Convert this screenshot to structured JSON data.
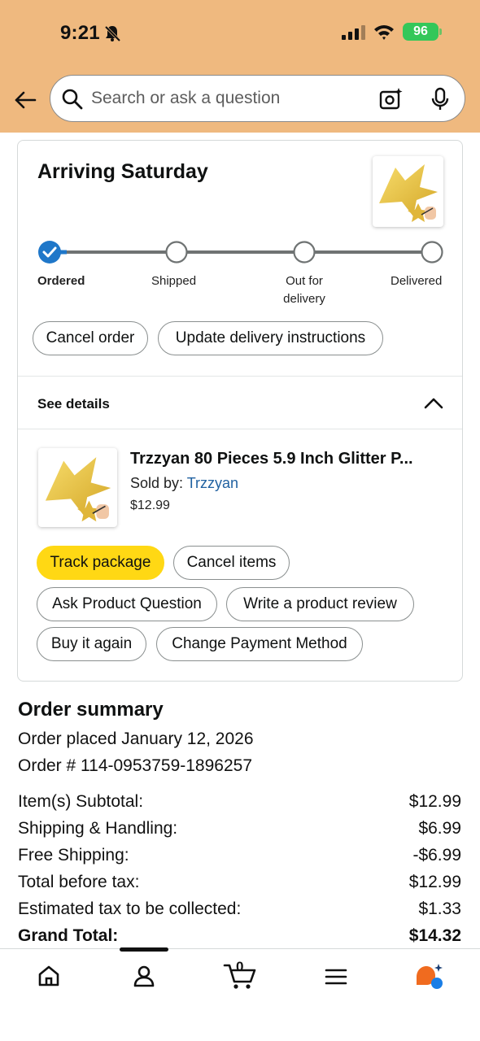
{
  "status_bar": {
    "time": "9:21",
    "battery": "96"
  },
  "search": {
    "placeholder": "Search or ask a question"
  },
  "delivery": {
    "heading": "Arriving Saturday",
    "steps": [
      "Ordered",
      "Shipped",
      "Out for delivery",
      "Delivered"
    ],
    "current_step": 0,
    "step_ofd_line1": "Out for",
    "step_ofd_line2": "delivery",
    "cancel_order": "Cancel order",
    "update_instructions": "Update delivery instructions"
  },
  "details": {
    "label": "See details"
  },
  "item": {
    "title": "Trzzyan 80 Pieces 5.9 Inch Glitter P...",
    "sold_by_label": "Sold by: ",
    "seller": "Trzzyan",
    "price": "$12.99"
  },
  "actions": {
    "track_package": "Track package",
    "cancel_items": "Cancel items",
    "ask_question": "Ask Product Question",
    "write_review": "Write a product review",
    "buy_again": "Buy it again",
    "change_payment": "Change Payment Method"
  },
  "summary": {
    "title": "Order summary",
    "placed": "Order placed January 12, 2026",
    "order_number": "Order # 114-0953759-1896257",
    "rows": [
      {
        "label": "Item(s) Subtotal:",
        "value": "$12.99"
      },
      {
        "label": "Shipping & Handling:",
        "value": "$6.99"
      },
      {
        "label": "Free Shipping:",
        "value": "-$6.99"
      },
      {
        "label": "Total before tax:",
        "value": "$12.99"
      },
      {
        "label": "Estimated tax to be collected:",
        "value": "$1.33"
      },
      {
        "label": "Grand Total:",
        "value": "$14.32"
      }
    ]
  },
  "bottom_nav": {
    "cart_count": "0",
    "icons": [
      "home-icon",
      "account-icon",
      "cart-icon",
      "menu-icon",
      "rufus-icon"
    ]
  },
  "colors": {
    "header_bg": "#efb97f",
    "progress_blue": "#1f77c9",
    "track_button": "#ffd814",
    "seller_link": "#2162a1",
    "battery_green": "#34c759"
  }
}
